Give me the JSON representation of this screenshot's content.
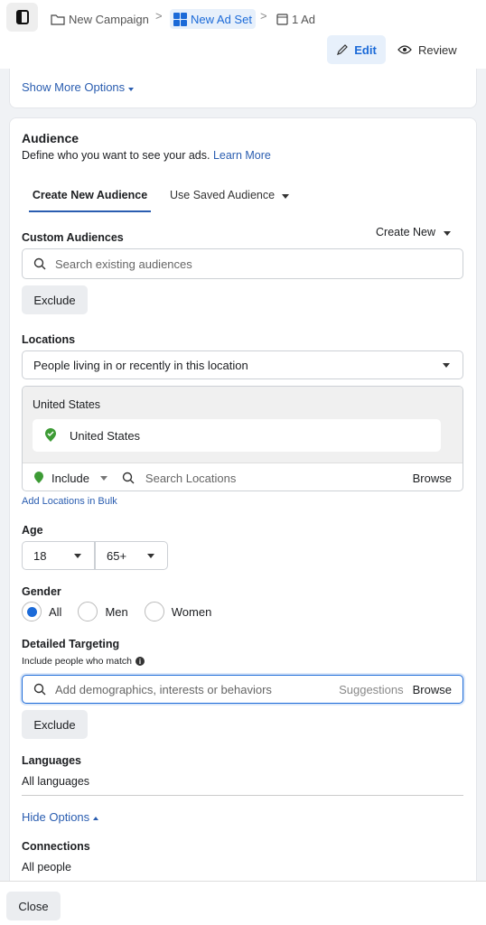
{
  "breadcrumb": {
    "campaign": "New Campaign",
    "adset": "New Ad Set",
    "ad": "1 Ad"
  },
  "mode": {
    "edit": "Edit",
    "review": "Review"
  },
  "top_card": {
    "show_more": "Show More Options"
  },
  "audience": {
    "title": "Audience",
    "description": "Define who you want to see your ads.",
    "learn_more": "Learn More",
    "tabs": [
      {
        "label": "Create New Audience",
        "active": true
      },
      {
        "label": "Use Saved Audience"
      }
    ],
    "custom_audiences": {
      "label": "Custom Audiences",
      "create_new": "Create New",
      "search_placeholder": "Search existing audiences",
      "exclude": "Exclude"
    },
    "locations": {
      "label": "Locations",
      "type": "People living in or recently in this location",
      "group": "United States",
      "items": [
        "United States"
      ],
      "include": "Include",
      "search_placeholder": "Search Locations",
      "browse": "Browse",
      "bulk": "Add Locations in Bulk"
    },
    "age": {
      "label": "Age",
      "min": "18",
      "max": "65+"
    },
    "gender": {
      "label": "Gender",
      "options": [
        "All",
        "Men",
        "Women"
      ],
      "selected": "All"
    },
    "detailed": {
      "label": "Detailed Targeting",
      "sub": "Include people who match",
      "placeholder": "Add demographics, interests or behaviors",
      "suggestions": "Suggestions",
      "browse": "Browse",
      "exclude": "Exclude"
    },
    "languages": {
      "label": "Languages",
      "value": "All languages"
    },
    "hide_options": "Hide Options",
    "connections": {
      "label": "Connections",
      "value": "All people"
    }
  },
  "footer": {
    "close": "Close"
  },
  "colors": {
    "accent": "#1b6ad8",
    "link": "#2a5db0",
    "green": "#3d9b35"
  }
}
